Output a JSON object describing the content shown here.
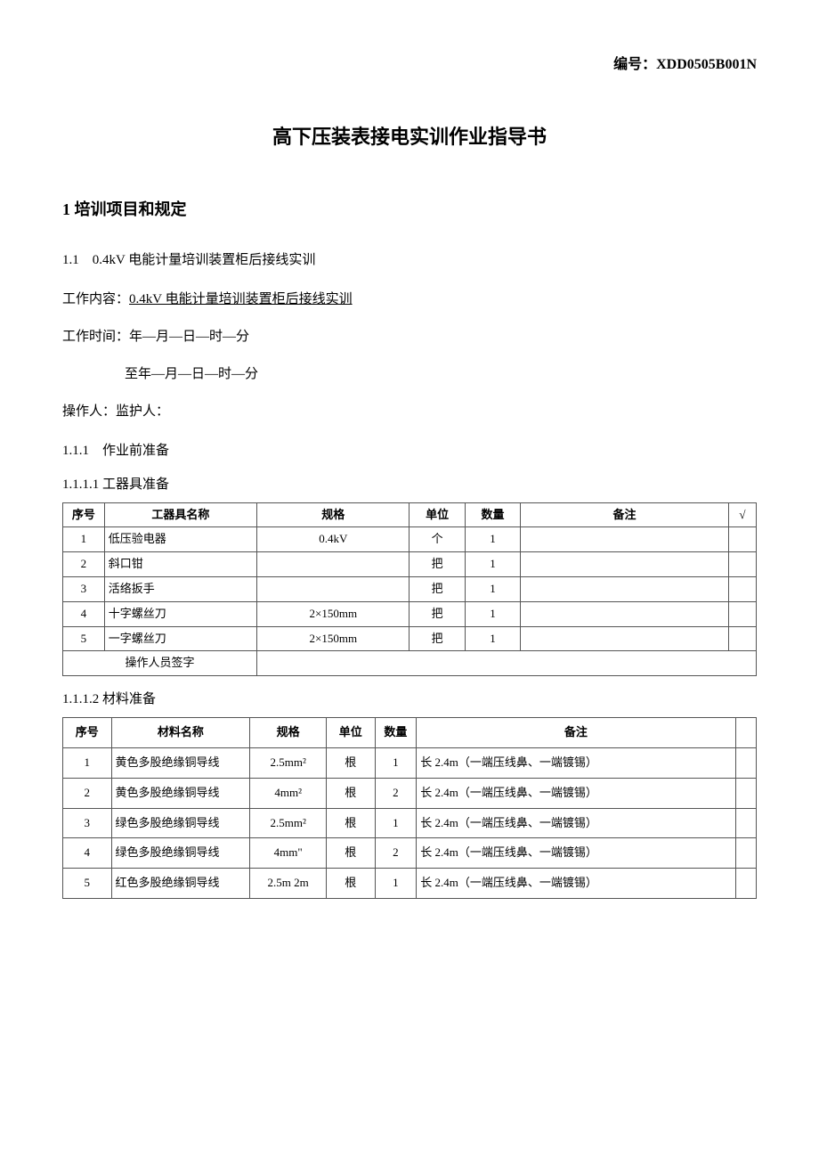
{
  "doc_id_label": "编号：",
  "doc_id": "XDD0505B001N",
  "title": "高下压装表接电实训作业指导书",
  "section1": {
    "heading": "1 培训项目和规定",
    "sub11": "1.1　0.4kV 电能计量培训装置柜后接线实训",
    "work_content_label": "工作内容：",
    "work_content": "0.4kV 电能计量培训装置柜后接线实训",
    "work_time_line1": "工作时间：年—月—日—时—分",
    "work_time_line2": "至年—月—日—时—分",
    "operator_line": "操作人：监护人：",
    "sub111": "1.1.1　作业前准备",
    "sub1111": "1.1.1.1 工器具准备",
    "sub1112": "1.1.1.2 材料准备"
  },
  "table1": {
    "headers": [
      "序号",
      "工器具名称",
      "规格",
      "单位",
      "数量",
      "备注",
      "√"
    ],
    "rows": [
      {
        "no": "1",
        "name": "低压验电器",
        "spec": "0.4kV",
        "unit": "个",
        "qty": "1",
        "remark": ""
      },
      {
        "no": "2",
        "name": "斜口钳",
        "spec": "",
        "unit": "把",
        "qty": "1",
        "remark": ""
      },
      {
        "no": "3",
        "name": "活络扳手",
        "spec": "",
        "unit": "把",
        "qty": "1",
        "remark": ""
      },
      {
        "no": "4",
        "name": "十字螺丝刀",
        "spec": "2×150mm",
        "unit": "把",
        "qty": "1",
        "remark": ""
      },
      {
        "no": "5",
        "name": "一字螺丝刀",
        "spec": "2×150mm",
        "unit": "把",
        "qty": "1",
        "remark": ""
      }
    ],
    "signature_label": "操作人员签字"
  },
  "table2": {
    "headers": [
      "序号",
      "材料名称",
      "规格",
      "单位",
      "数量",
      "备注",
      ""
    ],
    "rows": [
      {
        "no": "1",
        "name": "黄色多股绝缘铜导线",
        "spec": "2.5mm²",
        "unit": "根",
        "qty": "1",
        "remark": "长 2.4m（一端压线鼻、一端镀锡）"
      },
      {
        "no": "2",
        "name": "黄色多股绝缘铜导线",
        "spec": "4mm²",
        "unit": "根",
        "qty": "2",
        "remark": "长 2.4m（一端压线鼻、一端镀锡）"
      },
      {
        "no": "3",
        "name": "绿色多股绝缘铜导线",
        "spec": "2.5mm²",
        "unit": "根",
        "qty": "1",
        "remark": "长 2.4m（一端压线鼻、一端镀锡）"
      },
      {
        "no": "4",
        "name": "绿色多股绝缘铜导线",
        "spec": "4mm\"",
        "unit": "根",
        "qty": "2",
        "remark": "长 2.4m（一端压线鼻、一端镀锡）"
      },
      {
        "no": "5",
        "name": "红色多股绝缘铜导线",
        "spec": "2.5m 2m",
        "unit": "根",
        "qty": "1",
        "remark": "长 2.4m（一端压线鼻、一端镀锡）"
      }
    ]
  }
}
